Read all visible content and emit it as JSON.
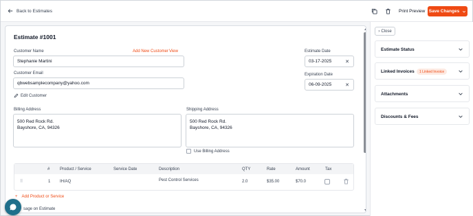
{
  "topbar": {
    "back_label": "Back to Estimates",
    "print_label": "Print Preview",
    "save_label": "Save Changes"
  },
  "estimate": {
    "title": "Estimate #1001",
    "customer_name_label": "Customer Name",
    "add_customer_link": "Add New Customer",
    "view_link": "View",
    "customer_name": "Stephanie Martini",
    "customer_email_label": "Customer Email",
    "customer_email": "qbwebsamplecompany@yahoo.com",
    "edit_customer": "Edit Customer",
    "estimate_date_label": "Estimate Date",
    "estimate_date": "03-17-2025",
    "expiration_date_label": "Expiration Date",
    "expiration_date": "06-09-2025",
    "billing_label": "Billing Address",
    "billing_line1": "500 Red Rock Rd.",
    "billing_line2": "Bayshore, CA, 94326",
    "shipping_label": "Shipping Address",
    "shipping_line1": "500 Red Rock Rd.",
    "shipping_line2": "Bayshore, CA, 94326",
    "use_billing": "Use Billing Address"
  },
  "table": {
    "headers": [
      "#",
      "Product / Service",
      "Service Date",
      "Description",
      "QTY",
      "Rate",
      "Amount",
      "Tax"
    ],
    "row": {
      "num": "1",
      "product": "IH/AQ",
      "service_date": "",
      "description": "Pest Control Services",
      "qty": "2.0",
      "rate": "$35.00",
      "amount": "$70.0"
    },
    "add_label": "Add Product or Service",
    "add_plus": "+"
  },
  "message_label": "sage on Estimate",
  "right_panel": {
    "close_label": "Close",
    "sections": [
      {
        "title": "Estimate Status"
      },
      {
        "title": "Linked Invoices",
        "badge": "1 Linked Invoice"
      },
      {
        "title": "Attachments"
      },
      {
        "title": "Discounts & Fees"
      }
    ]
  },
  "colors": {
    "accent": "#ef4a14",
    "chat": "#1f6f8b"
  }
}
